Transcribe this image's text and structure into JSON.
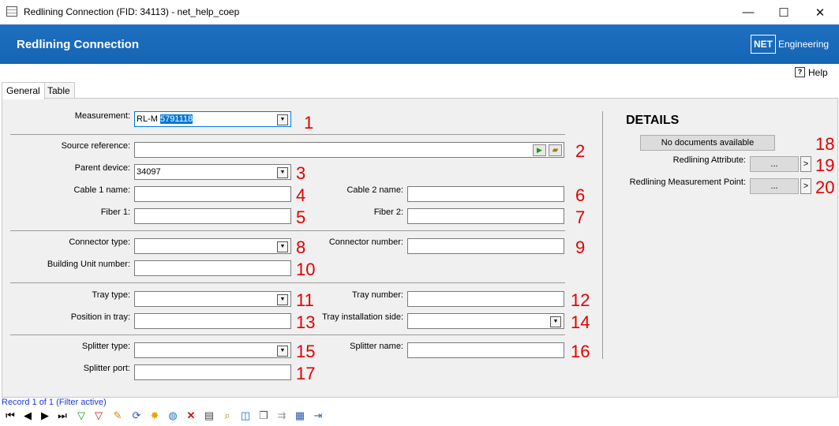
{
  "window": {
    "title": "Redlining Connection (FID: 34113) - net_help_coep",
    "minimize": "—",
    "maximize": "☐",
    "close": "✕"
  },
  "banner": {
    "title": "Redlining Connection",
    "logo_box": "NET",
    "logo_text": "Engineering",
    "brand_color": "#1565b5"
  },
  "help": {
    "label": "Help"
  },
  "tabs": [
    {
      "label": "General",
      "active": true
    },
    {
      "label": "Table",
      "active": false
    }
  ],
  "form": {
    "measurement": {
      "label": "Measurement:",
      "prefix": "RL-M",
      "selected": "5791118"
    },
    "source_reference": {
      "label": "Source reference:",
      "value": ""
    },
    "parent_device": {
      "label": "Parent device:",
      "value": "34097"
    },
    "cable1_name": {
      "label": "Cable 1 name:",
      "value": ""
    },
    "cable2_name": {
      "label": "Cable 2 name:",
      "value": ""
    },
    "fiber1": {
      "label": "Fiber 1:",
      "value": ""
    },
    "fiber2": {
      "label": "Fiber 2:",
      "value": ""
    },
    "connector_type": {
      "label": "Connector type:",
      "value": ""
    },
    "connector_number": {
      "label": "Connector number:",
      "value": ""
    },
    "building_unit_number": {
      "label": "Building Unit number:",
      "value": ""
    },
    "tray_type": {
      "label": "Tray type:",
      "value": ""
    },
    "tray_number": {
      "label": "Tray number:",
      "value": ""
    },
    "position_in_tray": {
      "label": "Position in tray:",
      "value": ""
    },
    "tray_installation_side": {
      "label": "Tray installation side:",
      "value": ""
    },
    "splitter_type": {
      "label": "Splitter type:",
      "value": ""
    },
    "splitter_name": {
      "label": "Splitter name:",
      "value": ""
    },
    "splitter_port": {
      "label": "Splitter port:",
      "value": ""
    }
  },
  "details": {
    "heading": "DETAILS",
    "no_documents": "No documents available",
    "redlining_attribute": {
      "label": "Redlining Attribute:",
      "button": "...",
      "arrow": ">"
    },
    "redlining_measurement_point": {
      "label": "Redlining Measurement Point:",
      "button": "...",
      "arrow": ">"
    }
  },
  "annotations": [
    "1",
    "2",
    "3",
    "4",
    "5",
    "6",
    "7",
    "8",
    "9",
    "10",
    "11",
    "12",
    "13",
    "14",
    "15",
    "16",
    "17",
    "18",
    "19",
    "20"
  ],
  "status": {
    "text": "Record 1 of 1 (Filter active)"
  },
  "toolbar_icons": [
    "first-record-icon",
    "previous-record-icon",
    "next-record-icon",
    "last-record-icon",
    "filter-add-icon",
    "filter-remove-icon",
    "edit-pencil-icon",
    "refresh-icon",
    "new-star-icon",
    "globe-locate-icon",
    "delete-x-icon",
    "print-icon",
    "zoom-icon",
    "select-icon",
    "copy-icon",
    "connect-icon",
    "table-edit-icon",
    "exit-icon"
  ]
}
